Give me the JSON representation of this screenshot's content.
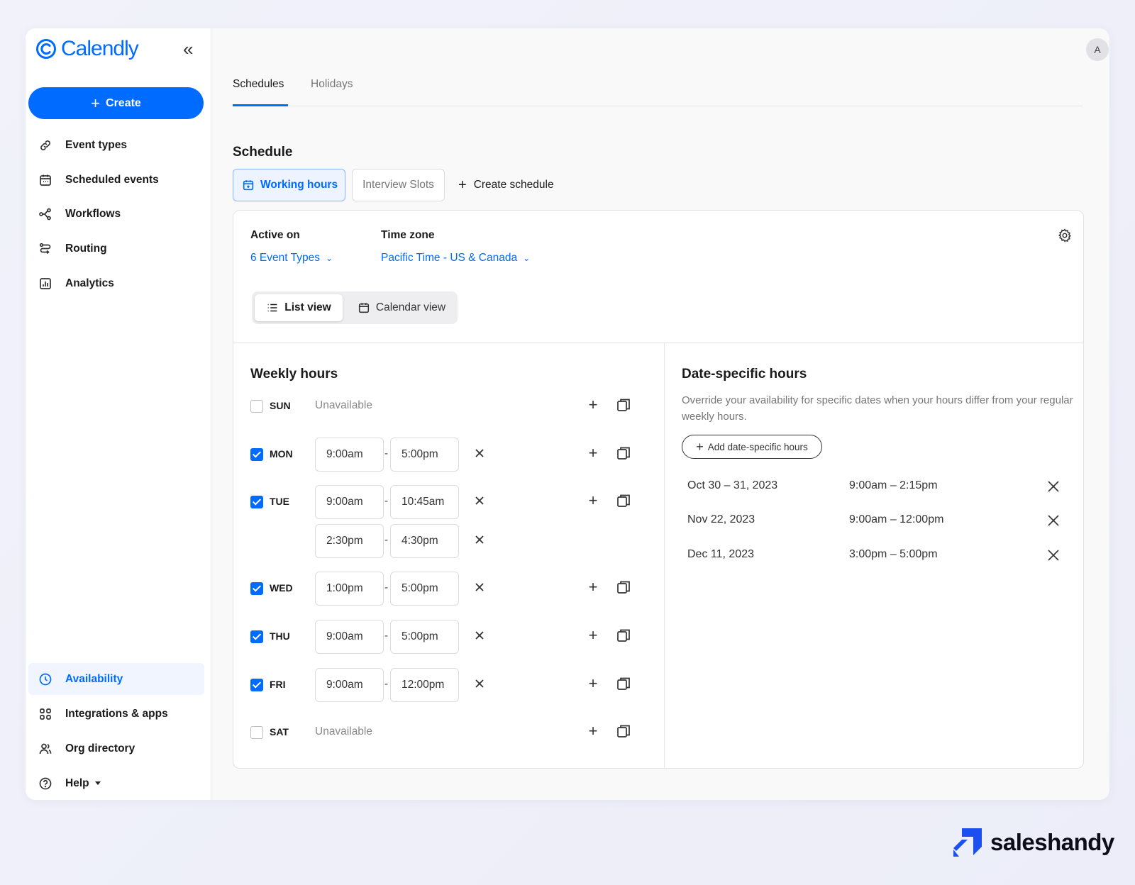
{
  "app": {
    "brand": "Calendly",
    "avatar_initial": "A"
  },
  "sidebar": {
    "create_label": "Create",
    "items": [
      {
        "label": "Event types",
        "icon": "link-icon"
      },
      {
        "label": "Scheduled events",
        "icon": "calendar-icon"
      },
      {
        "label": "Workflows",
        "icon": "workflow-icon"
      },
      {
        "label": "Routing",
        "icon": "routing-icon"
      },
      {
        "label": "Analytics",
        "icon": "analytics-icon"
      }
    ],
    "bottom_items": [
      {
        "label": "Availability",
        "icon": "clock-icon",
        "active": true
      },
      {
        "label": "Integrations & apps",
        "icon": "grid-icon"
      },
      {
        "label": "Org directory",
        "icon": "people-icon"
      },
      {
        "label": "Help",
        "icon": "help-icon"
      }
    ]
  },
  "tabs": [
    "Schedules",
    "Holidays"
  ],
  "schedule": {
    "title": "Schedule",
    "chips": {
      "working_hours": "Working hours",
      "interview_slots": "Interview Slots",
      "create_schedule": "Create schedule"
    },
    "active_on_label": "Active on",
    "active_on_value": "6 Event Types",
    "timezone_label": "Time zone",
    "timezone_value": "Pacific Time - US & Canada",
    "view_toggle": {
      "list": "List view",
      "calendar": "Calendar view",
      "selected": "List view"
    }
  },
  "weekly": {
    "title": "Weekly hours",
    "unavailable": "Unavailable",
    "days": {
      "sun": {
        "label": "SUN",
        "checked": false
      },
      "mon": {
        "label": "MON",
        "checked": true,
        "slots": [
          [
            "9:00am",
            "5:00pm"
          ]
        ]
      },
      "tue": {
        "label": "TUE",
        "checked": true,
        "slots": [
          [
            "9:00am",
            "10:45am"
          ],
          [
            "2:30pm",
            "4:30pm"
          ]
        ]
      },
      "wed": {
        "label": "WED",
        "checked": true,
        "slots": [
          [
            "1:00pm",
            "5:00pm"
          ]
        ]
      },
      "thu": {
        "label": "THU",
        "checked": true,
        "slots": [
          [
            "9:00am",
            "5:00pm"
          ]
        ]
      },
      "fri": {
        "label": "FRI",
        "checked": true,
        "slots": [
          [
            "9:00am",
            "12:00pm"
          ]
        ]
      },
      "sat": {
        "label": "SAT",
        "checked": false
      }
    }
  },
  "date_specific": {
    "title": "Date-specific hours",
    "description": "Override your availability for specific dates when your hours differ from your regular weekly hours.",
    "add_label": "Add date-specific hours",
    "entries": [
      {
        "date": "Oct 30 – 31, 2023",
        "time": "9:00am – 2:15pm"
      },
      {
        "date": "Nov 22, 2023",
        "time": "9:00am – 12:00pm"
      },
      {
        "date": "Dec 11, 2023",
        "time": "3:00pm – 5:00pm"
      }
    ]
  },
  "watermark": {
    "text": "saleshandy"
  },
  "colors": {
    "accent": "#006bff",
    "active_bg": "#f0f5ff",
    "brand_dark": "#0d0d1a"
  }
}
